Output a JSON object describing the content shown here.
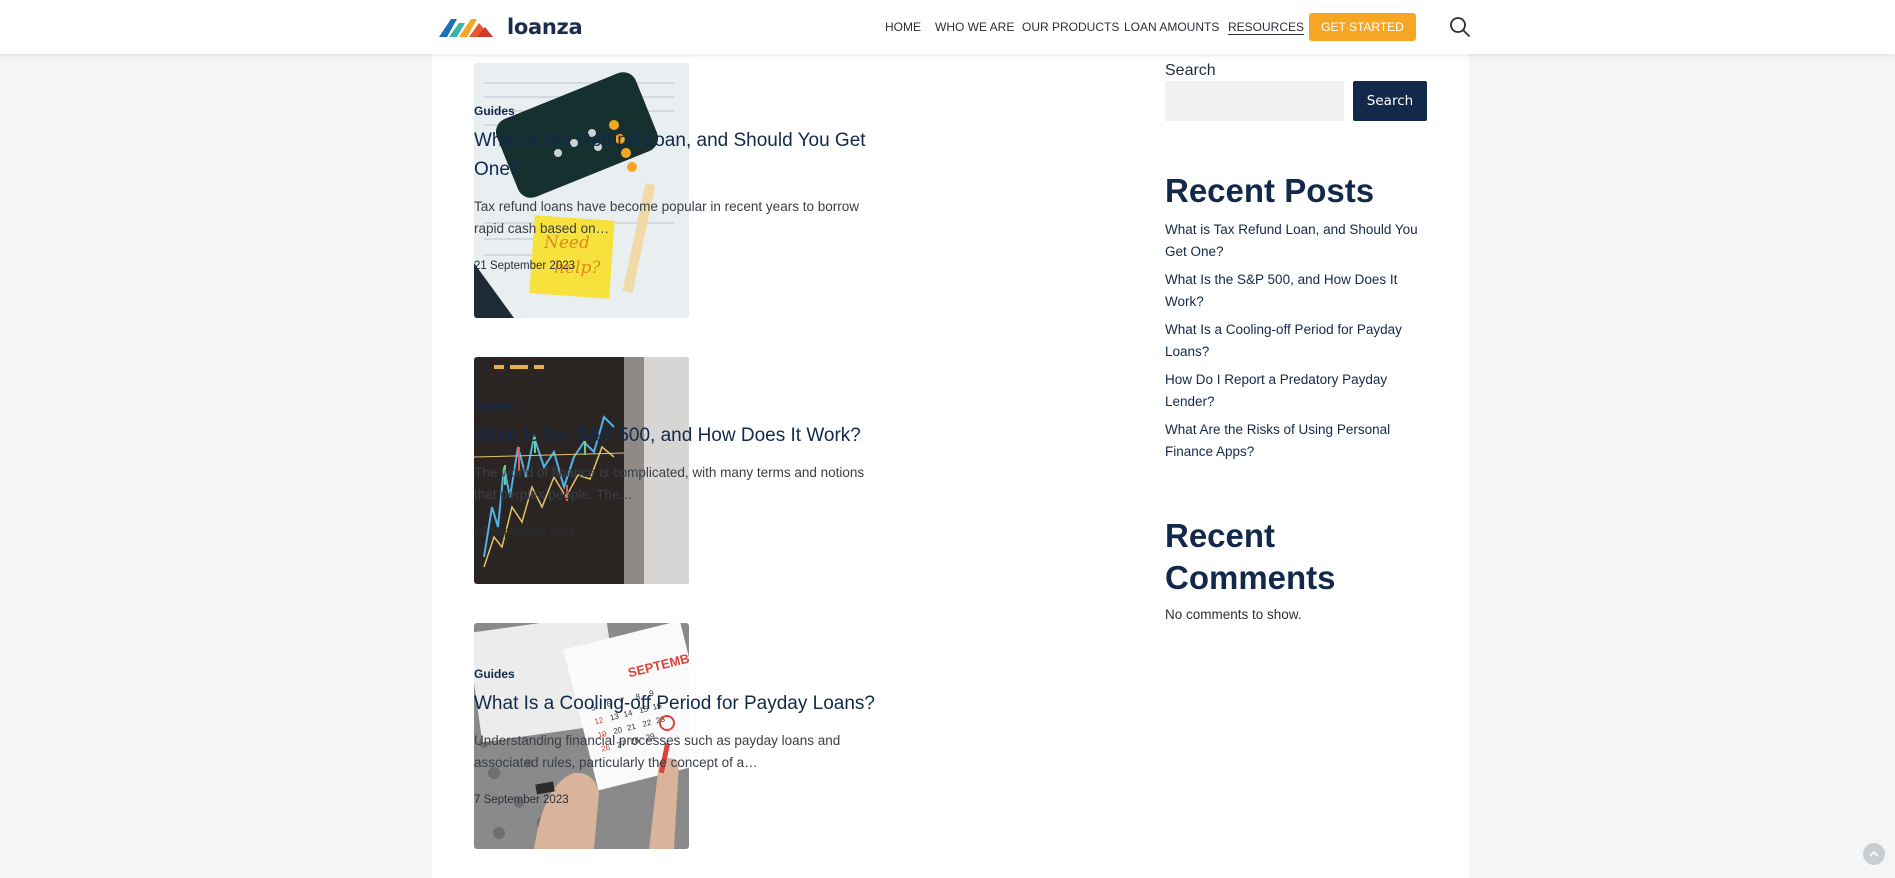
{
  "brand": {
    "name": "loanza",
    "accent": "#f5a623",
    "primary": "#13294b"
  },
  "nav": {
    "items": [
      {
        "label": "HOME"
      },
      {
        "label": "WHO WE ARE"
      },
      {
        "label": "OUR PRODUCTS"
      },
      {
        "label": "LOAN AMOUNTS"
      },
      {
        "label": "RESOURCES",
        "active": true
      }
    ],
    "cta": "GET STARTED",
    "search_icon": "search-icon"
  },
  "posts": [
    {
      "category": "Guides",
      "title": "What is Tax Refund Loan, and Should You Get One?",
      "excerpt": "Tax refund loans have become popular in recent years to borrow rapid cash based on…",
      "date": "21 September 2023",
      "image": "calculator-and-sticky-note"
    },
    {
      "category": "Guides",
      "title": "What Is the S&P 500, and How Does It Work?",
      "excerpt": "The world of finance is complicated, with many terms and notions that perplex people. The…",
      "date": "14 September 2023",
      "image": "stock-chart-screen"
    },
    {
      "category": "Guides",
      "title": "What Is a Cooling-off Period for Payday Loans?",
      "excerpt": "Understanding financial processes such as payday loans and associated rules, particularly the concept of a…",
      "date": "7 September 2023",
      "image": "calendar-september"
    }
  ],
  "sidebar": {
    "search_label": "Search",
    "search_value": "",
    "search_button": "Search",
    "recent_posts_title": "Recent Posts",
    "recent_posts": [
      "What is Tax Refund Loan, and Should You Get One?",
      "What Is the S&P 500, and How Does It Work?",
      "What Is a Cooling-off Period for Payday Loans?",
      "How Do I Report a Predatory Payday Lender?",
      "What Are the Risks of Using Personal Finance Apps?"
    ],
    "recent_comments_title": "Recent Comments",
    "no_comments": "No comments to show."
  }
}
